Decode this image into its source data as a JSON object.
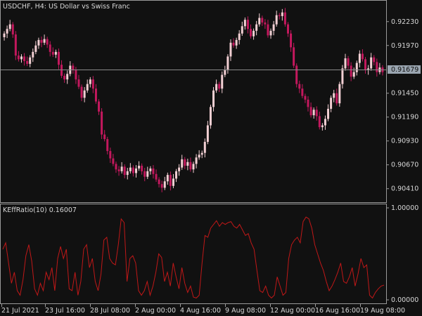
{
  "window": {
    "symbol_line": "USDCHF, H4:  US Dollar vs Swiss Franc"
  },
  "colors": {
    "background": "#111111",
    "grid_border": "#9a9a9a",
    "bull_candle": "#f2cfd3",
    "bear_candle": "#c3185d",
    "indicator_line": "#c01818",
    "bid_line": "#8a8a8a",
    "bid_label_bg": "#9aa5b0",
    "text": "#d8d8d8"
  },
  "price_axis": {
    "ticks": [
      "0.92230",
      "0.91970",
      "0.91450",
      "0.91190",
      "0.90930",
      "0.90670",
      "0.90410"
    ],
    "current_price_label": "0.91679"
  },
  "indicator": {
    "label": "KEffRatio(10) 0.16007",
    "ticks": [
      "1.00000",
      "0.00000"
    ]
  },
  "time_axis": {
    "labels": [
      "21 Jul 2021",
      "23 Jul 16:00",
      "28 Jul 08:00",
      "2 Aug 00:00",
      "4 Aug 16:00",
      "9 Aug 08:00",
      "12 Aug 00:00",
      "16 Aug 16:00",
      "19 Aug 08:00"
    ]
  },
  "chart_data": [
    {
      "type": "candlestick",
      "title": "USDCHF, H4:  US Dollar vs Swiss Franc",
      "ylim": [
        0.9027,
        0.9245
      ],
      "current_price": 0.91679,
      "candles_close": [
        0.921,
        0.9215,
        0.922,
        0.9209,
        0.9186,
        0.9182,
        0.9185,
        0.918,
        0.9177,
        0.9184,
        0.919,
        0.9197,
        0.9203,
        0.92,
        0.9204,
        0.9198,
        0.919,
        0.9187,
        0.919,
        0.9176,
        0.9164,
        0.916,
        0.9166,
        0.9175,
        0.917,
        0.916,
        0.9152,
        0.914,
        0.9148,
        0.9155,
        0.916,
        0.915,
        0.9136,
        0.9125,
        0.91,
        0.9095,
        0.9082,
        0.9074,
        0.9068,
        0.9062,
        0.906,
        0.9065,
        0.9056,
        0.906,
        0.9064,
        0.9058,
        0.9063,
        0.9066,
        0.906,
        0.9054,
        0.906,
        0.9063,
        0.9057,
        0.9051,
        0.9046,
        0.9042,
        0.9049,
        0.9056,
        0.9044,
        0.9052,
        0.906,
        0.9064,
        0.9073,
        0.9066,
        0.907,
        0.9062,
        0.9068,
        0.9075,
        0.9078,
        0.908,
        0.9092,
        0.911,
        0.913,
        0.9148,
        0.9155,
        0.915,
        0.9165,
        0.917,
        0.9185,
        0.92,
        0.9197,
        0.9203,
        0.921,
        0.9218,
        0.9225,
        0.9215,
        0.9207,
        0.9213,
        0.922,
        0.9227,
        0.9222,
        0.922,
        0.9208,
        0.9213,
        0.922,
        0.923,
        0.9229,
        0.9233,
        0.922,
        0.921,
        0.9195,
        0.9175,
        0.9155,
        0.915,
        0.9142,
        0.9138,
        0.913,
        0.9121,
        0.9127,
        0.912,
        0.9108,
        0.911,
        0.9117,
        0.9128,
        0.914,
        0.9145,
        0.9134,
        0.9155,
        0.9172,
        0.9183,
        0.9175,
        0.9163,
        0.9168,
        0.9178,
        0.9188,
        0.9182,
        0.917,
        0.9172,
        0.9184,
        0.9179,
        0.9168,
        0.9173,
        0.9168
      ]
    },
    {
      "type": "line",
      "title": "KEffRatio(10) 0.16007",
      "ylim": [
        0,
        1
      ],
      "values": [
        0.55,
        0.62,
        0.4,
        0.18,
        0.3,
        0.1,
        0.05,
        0.22,
        0.48,
        0.6,
        0.42,
        0.12,
        0.05,
        0.18,
        0.1,
        0.3,
        0.22,
        0.35,
        0.1,
        0.45,
        0.58,
        0.45,
        0.55,
        0.12,
        0.1,
        0.3,
        0.05,
        0.2,
        0.55,
        0.6,
        0.35,
        0.45,
        0.2,
        0.1,
        0.28,
        0.65,
        0.68,
        0.45,
        0.4,
        0.38,
        0.6,
        0.88,
        0.84,
        0.2,
        0.45,
        0.48,
        0.4,
        0.1,
        0.05,
        0.1,
        0.2,
        0.05,
        0.15,
        0.3,
        0.5,
        0.46,
        0.2,
        0.3,
        0.15,
        0.4,
        0.25,
        0.12,
        0.35,
        0.18,
        0.08,
        0.15,
        0.03,
        0.02,
        0.05,
        0.4,
        0.7,
        0.68,
        0.78,
        0.82,
        0.86,
        0.8,
        0.84,
        0.82,
        0.84,
        0.85,
        0.8,
        0.78,
        0.82,
        0.76,
        0.7,
        0.72,
        0.62,
        0.55,
        0.32,
        0.1,
        0.08,
        0.15,
        0.05,
        0.02,
        0.05,
        0.25,
        0.15,
        0.05,
        0.08,
        0.45,
        0.6,
        0.65,
        0.68,
        0.62,
        0.85,
        0.9,
        0.88,
        0.78,
        0.6,
        0.5,
        0.4,
        0.32,
        0.2,
        0.1,
        0.15,
        0.22,
        0.3,
        0.4,
        0.2,
        0.18,
        0.25,
        0.35,
        0.15,
        0.28,
        0.45,
        0.35,
        0.38,
        0.05,
        0.02,
        0.08,
        0.12,
        0.15,
        0.16
      ]
    }
  ]
}
